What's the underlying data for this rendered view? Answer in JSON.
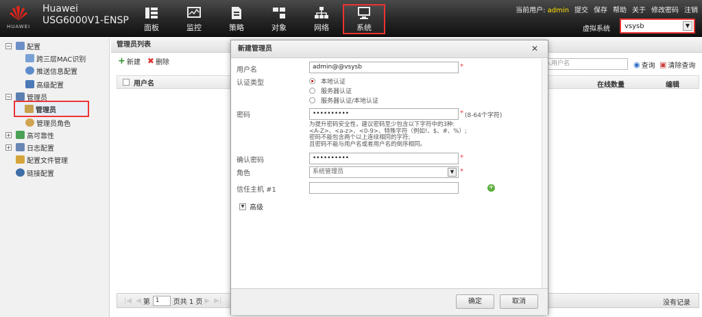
{
  "app": {
    "logo_text": "HUAWEI",
    "brand_line1": "Huawei",
    "brand_line2": "USG6000V1-ENSP"
  },
  "nav": {
    "items": [
      {
        "label": "面板",
        "icon": "dashboard-icon"
      },
      {
        "label": "监控",
        "icon": "monitor-icon"
      },
      {
        "label": "策略",
        "icon": "policy-icon"
      },
      {
        "label": "对象",
        "icon": "object-icon"
      },
      {
        "label": "网络",
        "icon": "network-icon"
      },
      {
        "label": "系统",
        "icon": "system-icon",
        "active": true
      }
    ]
  },
  "top_links": {
    "current_user_label": "当前用户:",
    "current_user": "admin",
    "commit": "提交",
    "save": "保存",
    "help": "帮助",
    "about": "关于",
    "change_password": "修改密码",
    "logout": "注销"
  },
  "vsys": {
    "label": "虚拟系统",
    "value": "vsysb"
  },
  "sidebar": {
    "items": [
      {
        "label": "配置",
        "toggle": "−"
      },
      {
        "label": "跨三层MAC识别"
      },
      {
        "label": "推送信息配置"
      },
      {
        "label": "高级配置"
      },
      {
        "label": "管理员",
        "toggle": "−"
      },
      {
        "label": "管理员",
        "selected": true
      },
      {
        "label": "管理员角色"
      },
      {
        "label": "高可靠性",
        "toggle": "+"
      },
      {
        "label": "日志配置",
        "toggle": "+"
      },
      {
        "label": "配置文件管理"
      },
      {
        "label": "链接配置"
      }
    ]
  },
  "panel": {
    "title": "管理员列表",
    "new_label": "新建",
    "delete_label": "删除",
    "search_placeholder": "入用户名",
    "search_label": "查询",
    "clear_label": "清除查询",
    "col_username": "用户名",
    "col_online": "在线数量",
    "col_edit": "编辑",
    "pager": {
      "page_prefix": "第",
      "page": "1",
      "page_suffix": "页共 1 页",
      "no_records": "没有记录"
    }
  },
  "modal": {
    "title": "新建管理员",
    "username_label": "用户名",
    "username_value": "admin@@vsysb",
    "auth_type_label": "认证类型",
    "auth_options": [
      "本地认证",
      "服务器认证",
      "服务器认证/本地认证"
    ],
    "password_label": "密码",
    "password_value": "••••••••••",
    "password_hint_range": "(8-64个字符)",
    "password_hint": [
      "为提升密码安全性，建议密码至少包含以下字符中的3种:",
      "<A-Z>、<a-z>、<0-9>、特殊字符（例如!、$、#、%）;",
      "密码不能包含两个以上连续相同的字符;",
      "且密码不能与用户名或者用户名的倒序相同。"
    ],
    "confirm_label": "确认密码",
    "confirm_value": "••••••••••",
    "role_label": "角色",
    "role_value": "系统管理员",
    "trusted_host_label": "信任主机 #1",
    "trusted_host_value": "",
    "required_mark": "*",
    "advanced_label": "高级",
    "ok_label": "确定",
    "cancel_label": "取消"
  },
  "colors": {
    "accent_red": "#e33333",
    "user_yellow": "#ffe000",
    "add_green": "#5cae3c"
  }
}
